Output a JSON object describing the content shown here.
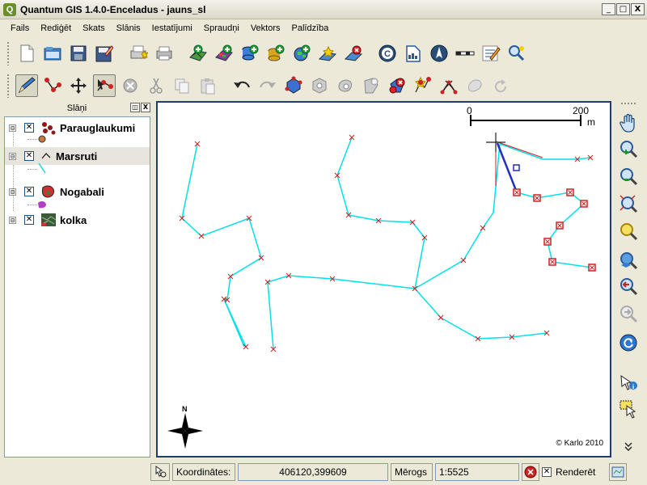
{
  "window": {
    "title": "Quantum GIS 1.4.0-Enceladus - jauns_sl",
    "buttons": [
      "_",
      "□",
      "X"
    ]
  },
  "menu": [
    "Fails",
    "Rediģēt",
    "Skats",
    "Slānis",
    "Iestatījumi",
    "Spraudņi",
    "Vektors",
    "Palīdzība"
  ],
  "toolbar1": [
    "new-project-icon",
    "open-project-icon",
    "save-project-icon",
    "save-as-icon",
    "print-composer-icon",
    "print-icon",
    "add-vector-layer-icon",
    "add-raster-layer-icon",
    "add-postgis-layer-icon",
    "add-spatialite-layer-icon",
    "add-wms-layer-icon",
    "new-vector-layer-icon",
    "remove-layer-icon",
    "copyright-label-icon",
    "gps-icon",
    "north-arrow-icon",
    "scale-bar-icon",
    "edit-note-icon",
    "plugins-icon"
  ],
  "toolbar2": [
    "toggle-editing-icon",
    "capture-point-icon",
    "move-feature-icon",
    "node-tool-icon",
    "delete-selected-icon",
    "cut-features-icon",
    "copy-features-icon",
    "paste-features-icon",
    "undo-icon",
    "redo-icon",
    "simplify-feature-icon",
    "add-ring-icon",
    "add-island-icon",
    "delete-ring-icon",
    "delete-part-icon",
    "reshape-features-icon",
    "split-features-icon",
    "merge-features-icon",
    "rotate-icon"
  ],
  "dock": {
    "title": "Slāņi",
    "float_btn": "◫",
    "close_btn": "X",
    "layers": [
      {
        "name": "Parauglaukumi",
        "checked": "✕",
        "expanded": "⊟"
      },
      {
        "name": "Marsruti",
        "checked": "✕",
        "expanded": "⊟"
      },
      {
        "name": "Nogabali",
        "checked": "✕",
        "expanded": "⊟"
      },
      {
        "name": "kolka",
        "checked": "✕",
        "expanded": "⊟"
      }
    ]
  },
  "map": {
    "scale_bar": {
      "left": "0",
      "right": "200",
      "unit": "m"
    },
    "north_label": "N",
    "copyright": "© Karlo 2010",
    "line_color": "#00e0e8",
    "vertex_color": "#cc2222",
    "edit_line_color": "#1f2fbf"
  },
  "right_toolbar": [
    "pan-icon",
    "zoom-in-icon",
    "zoom-out-icon",
    "zoom-full-icon",
    "zoom-selection-icon",
    "zoom-layer-icon",
    "zoom-last-icon",
    "zoom-next-icon",
    "refresh-icon",
    "identify-icon",
    "select-icon",
    "more-chevron-icon"
  ],
  "status": {
    "coords_label": "Koordinātes:",
    "coords_value": "406120,399609",
    "scale_label": "Mērogs",
    "scale_value": "1:5525",
    "render_label": "Renderēt",
    "render_checked": "✕"
  }
}
